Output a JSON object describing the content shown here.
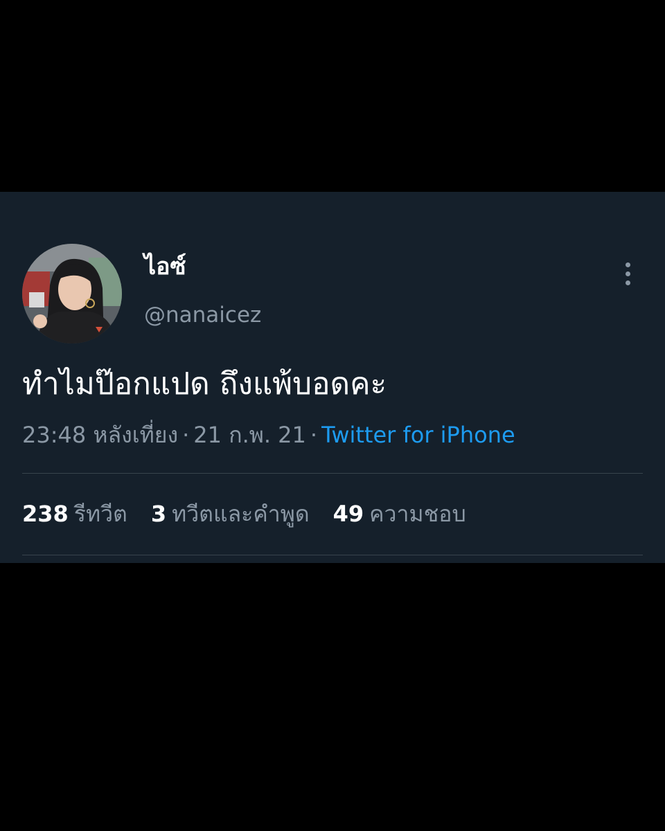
{
  "user": {
    "display_name": "ไอซ์",
    "handle": "@nanaicez"
  },
  "tweet": {
    "text": "ทำไมป๊อกแปด ถึงแพ้บอดคะ",
    "time": "23:48 หลังเที่ยง",
    "date": "21 ก.พ. 21",
    "source": "Twitter for iPhone",
    "separator": "·"
  },
  "stats": {
    "retweets": {
      "count": "238",
      "label": "รีทวีต"
    },
    "quotes": {
      "count": "3",
      "label": "ทวีตและคำพูด"
    },
    "likes": {
      "count": "49",
      "label": "ความชอบ"
    }
  },
  "icons": {
    "more": "more-vertical-icon"
  },
  "colors": {
    "background": "#000000",
    "card": "#15202b",
    "text": "#ffffff",
    "muted": "#8b98a5",
    "link": "#1d9bf0"
  }
}
